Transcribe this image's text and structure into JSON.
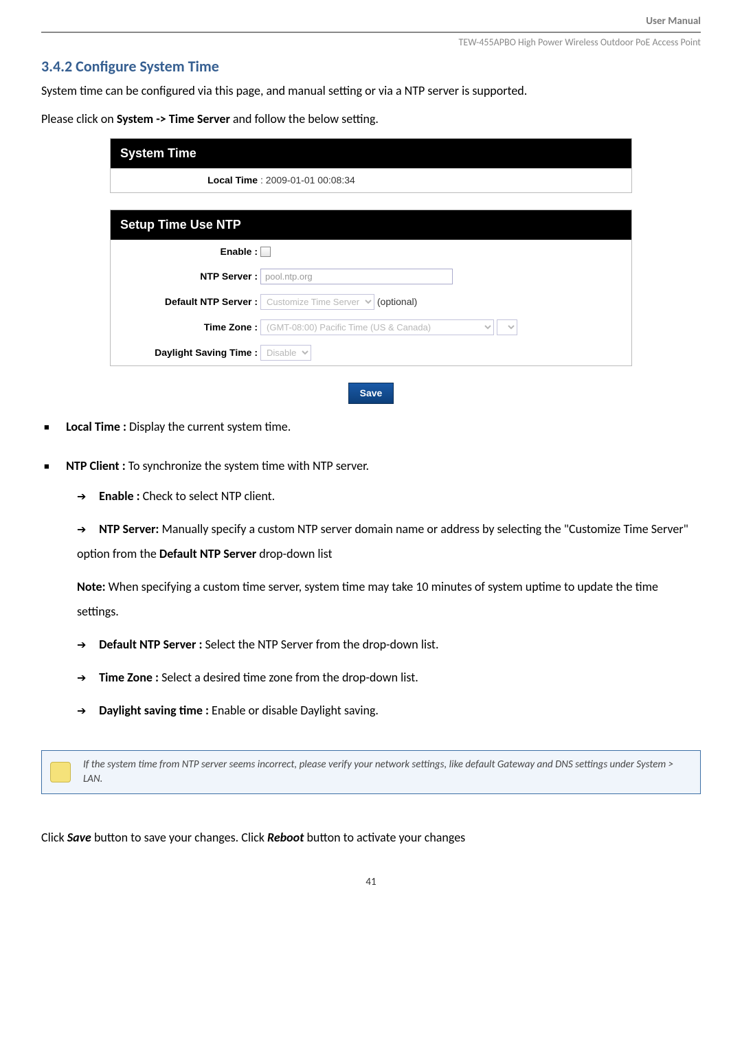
{
  "header": {
    "top_label": "User Manual",
    "product": "TEW-455APBO High Power Wireless Outdoor PoE Access Point"
  },
  "section": {
    "heading": "3.4.2 Configure System Time",
    "intro1": "System time can be configured via this page, and manual setting or via a NTP server is supported.",
    "intro2_pre": "Please click on ",
    "intro2_bold": "System -> Time Server",
    "intro2_post": " and follow the below setting."
  },
  "panel": {
    "system_time_header": "System Time",
    "local_time_label": "Local Time",
    "local_time_value": ": 2009-01-01 00:08:34",
    "setup_header": "Setup Time Use NTP",
    "enable_label": "Enable :",
    "ntp_server_label": "NTP Server :",
    "ntp_server_value": "pool.ntp.org",
    "default_ntp_label": "Default NTP Server :",
    "default_ntp_value": "Customize Time Server",
    "default_ntp_optional": "(optional)",
    "time_zone_label": "Time Zone :",
    "time_zone_value": "(GMT-08:00) Pacific Time (US & Canada)",
    "dst_label": "Daylight Saving Time :",
    "dst_value": "Disable",
    "save_button": "Save"
  },
  "bullets": {
    "local_time_label": "Local Time :",
    "local_time_desc": " Display the current system time.",
    "ntp_client_label": "NTP Client :",
    "ntp_client_desc": " To synchronize the system time with NTP server.",
    "enable_label": "Enable :",
    "enable_desc": " Check to select NTP client.",
    "ntp_server_label": "NTP Server:",
    "ntp_server_desc_pre": " Manually specify a custom NTP server domain name or address by selecting the \"Customize Time Server\" option from the ",
    "ntp_server_desc_bold": "Default NTP Server",
    "ntp_server_desc_post": " drop-down list",
    "note_label": "Note:",
    "note_desc": " When specifying a custom time server, system time may take 10 minutes of system uptime to update the time settings.",
    "default_ntp_label": "Default NTP Server :",
    "default_ntp_desc": " Select the NTP Server from the drop-down list.",
    "tz_label": "Time Zone :",
    "tz_desc": " Select a desired time zone from the drop-down list.",
    "dst_label": "Daylight saving time :",
    "dst_desc": " Enable or disable Daylight saving."
  },
  "callout": {
    "text": "If the system time from NTP server seems incorrect, please verify your network settings, like default Gateway and DNS settings under System > LAN."
  },
  "closing": {
    "pre": "Click ",
    "save": "Save",
    "mid": " button to save your changes. Click ",
    "reboot": "Reboot",
    "post": " button to activate your changes"
  },
  "page_number": "41"
}
